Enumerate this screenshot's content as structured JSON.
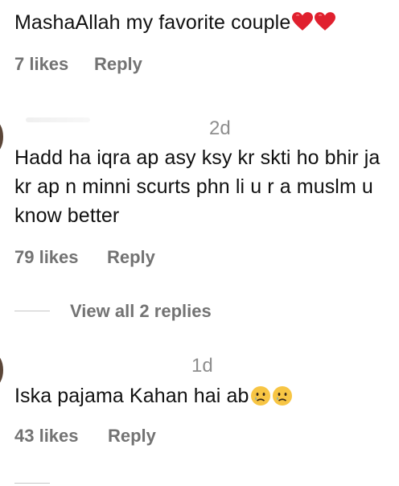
{
  "comments": [
    {
      "text": "MashaAllah my favorite couple",
      "emoji": [
        "red-heart-icon",
        "red-heart-icon"
      ],
      "likes": "7 likes",
      "reply_label": "Reply"
    },
    {
      "time": "2d",
      "text": "Hadd ha iqra ap asy ksy kr skti ho bhir ja kr ap n minni scurts phn li u r a muslm u know better",
      "likes": "79 likes",
      "reply_label": "Reply",
      "view_replies": "View all 2 replies"
    },
    {
      "time": "1d",
      "text": "Iska pajama Kahan hai ab",
      "emoji": [
        "crying-face-icon",
        "crying-face-icon"
      ],
      "likes": "43 likes",
      "reply_label": "Reply"
    }
  ],
  "colors": {
    "text": "#111111",
    "secondary": "#737373",
    "timestamp": "#8e8e8e",
    "divider": "#c7c7c7",
    "heart": "#e0202e",
    "emoji_face": "#f7c544"
  }
}
